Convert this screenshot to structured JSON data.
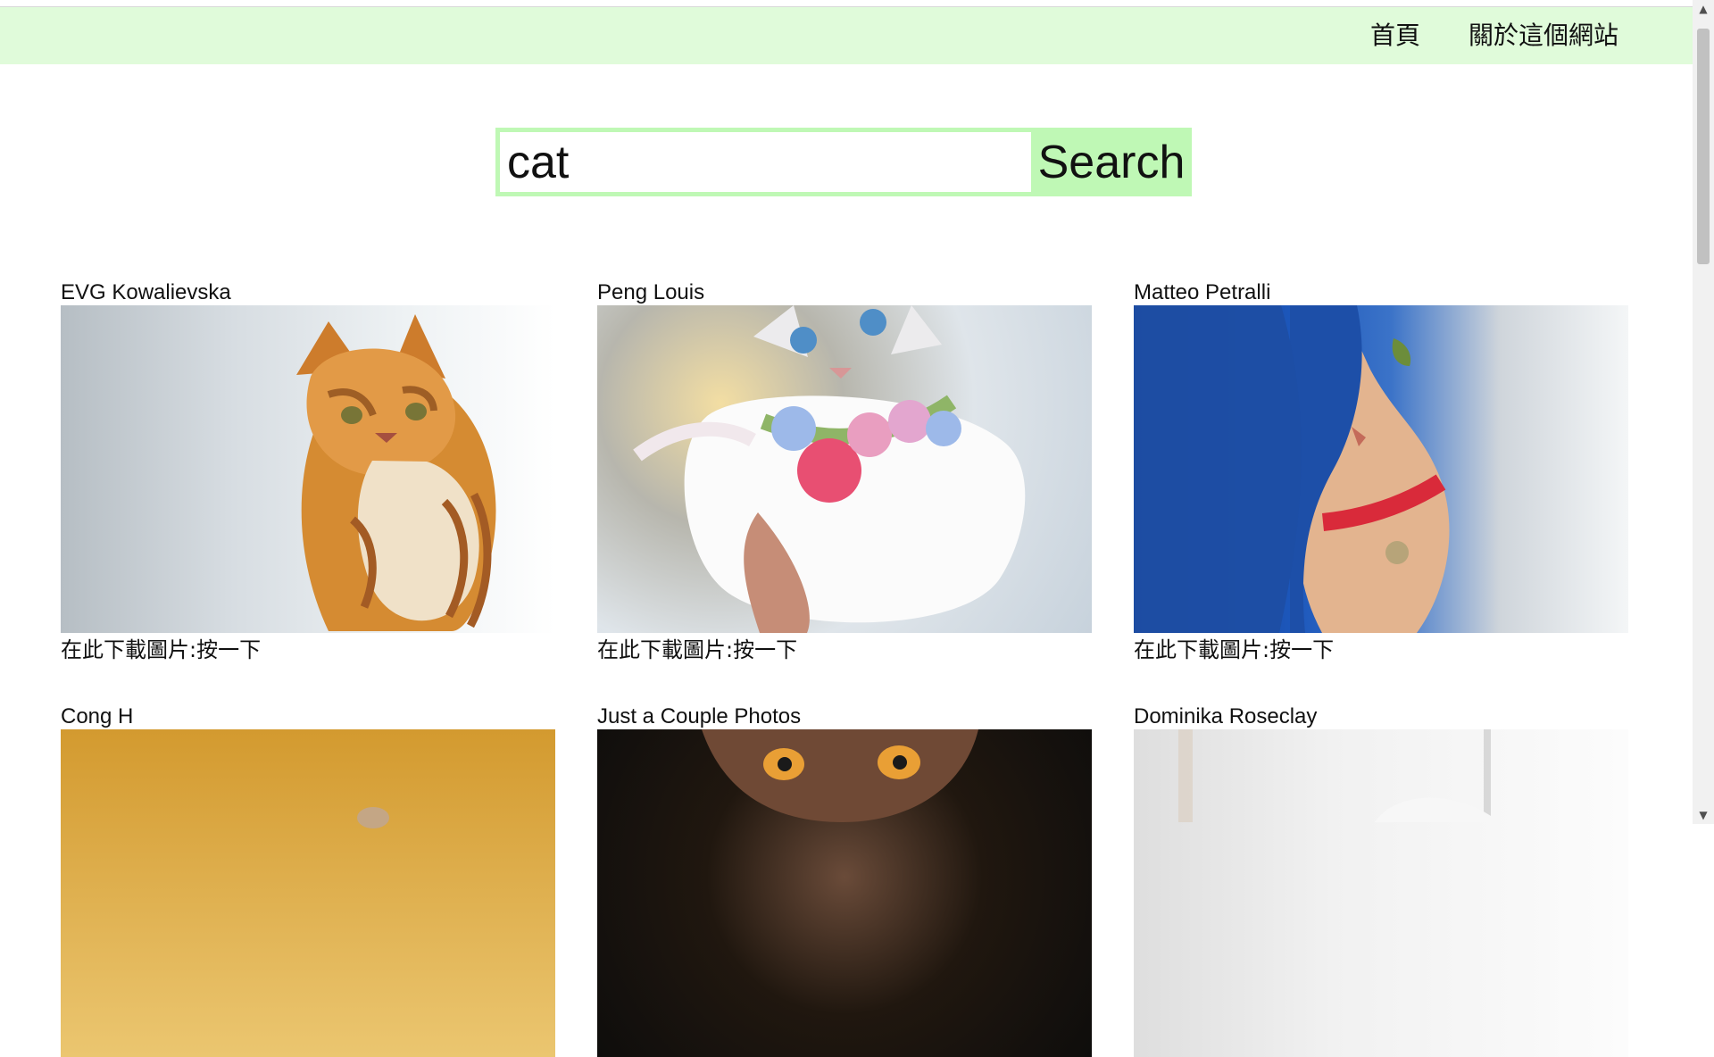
{
  "navbar": {
    "home_label": "首頁",
    "about_label": "關於這個網站",
    "background": "#e0fbda"
  },
  "search": {
    "value": "cat",
    "button_label": "Search",
    "accent": "#bff8b5"
  },
  "results": [
    {
      "author": "EVG Kowalievska",
      "download_text": "在此下載圖片:按一下"
    },
    {
      "author": "Peng Louis",
      "download_text": "在此下載圖片:按一下"
    },
    {
      "author": "Matteo Petralli",
      "download_text": "在此下載圖片:按一下"
    },
    {
      "author": "Cong H",
      "download_text": ""
    },
    {
      "author": "Just a Couple Photos",
      "download_text": ""
    },
    {
      "author": "Dominika Roseclay",
      "download_text": ""
    }
  ],
  "scrollbar": {
    "up_icon": "scroll-up-arrow-icon",
    "down_icon": "scroll-down-arrow-icon"
  }
}
